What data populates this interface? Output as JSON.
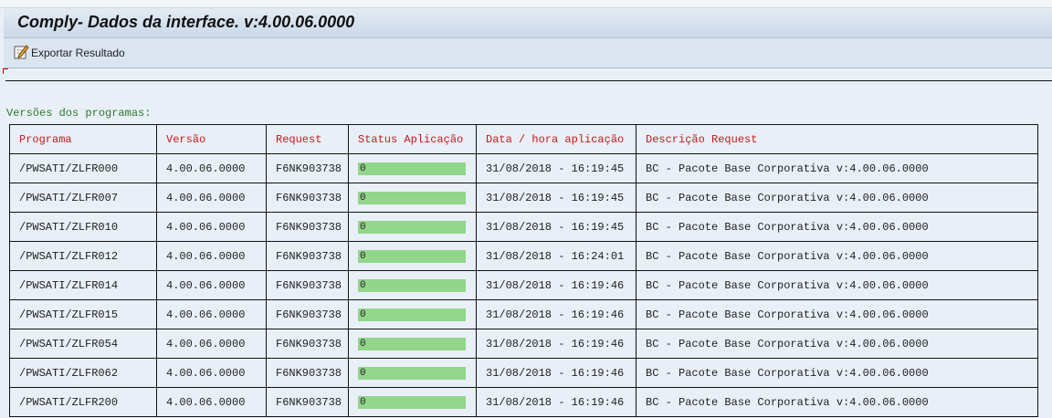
{
  "title": "Comply- Dados da interface. v:4.00.06.0000",
  "toolbar": {
    "export_label": "Exportar Resultado"
  },
  "section_label": "Versões dos programas:",
  "colors": {
    "status_bar": "#92d68b",
    "header_text": "#c41a1a",
    "label_text": "#2c7a2c"
  },
  "table": {
    "headers": [
      "Programa",
      "Versão",
      "Request",
      "Status Aplicação",
      "Data / hora aplicação",
      "Descrição Request"
    ],
    "rows": [
      {
        "programa": "/PWSATI/ZLFR000",
        "versao": "4.00.06.0000",
        "request": "F6NK903738",
        "status": "0",
        "data_hora": "31/08/2018 - 16:19:45",
        "descricao": "BC - Pacote Base Corporativa v:4.00.06.0000"
      },
      {
        "programa": "/PWSATI/ZLFR007",
        "versao": "4.00.06.0000",
        "request": "F6NK903738",
        "status": "0",
        "data_hora": "31/08/2018 - 16:19:45",
        "descricao": "BC - Pacote Base Corporativa v:4.00.06.0000"
      },
      {
        "programa": "/PWSATI/ZLFR010",
        "versao": "4.00.06.0000",
        "request": "F6NK903738",
        "status": "0",
        "data_hora": "31/08/2018 - 16:19:45",
        "descricao": "BC - Pacote Base Corporativa v:4.00.06.0000"
      },
      {
        "programa": "/PWSATI/ZLFR012",
        "versao": "4.00.06.0000",
        "request": "F6NK903738",
        "status": "0",
        "data_hora": "31/08/2018 - 16:24:01",
        "descricao": "BC - Pacote Base Corporativa v:4.00.06.0000"
      },
      {
        "programa": "/PWSATI/ZLFR014",
        "versao": "4.00.06.0000",
        "request": "F6NK903738",
        "status": "0",
        "data_hora": "31/08/2018 - 16:19:46",
        "descricao": "BC - Pacote Base Corporativa v:4.00.06.0000"
      },
      {
        "programa": "/PWSATI/ZLFR015",
        "versao": "4.00.06.0000",
        "request": "F6NK903738",
        "status": "0",
        "data_hora": "31/08/2018 - 16:19:46",
        "descricao": "BC - Pacote Base Corporativa v:4.00.06.0000"
      },
      {
        "programa": "/PWSATI/ZLFR054",
        "versao": "4.00.06.0000",
        "request": "F6NK903738",
        "status": "0",
        "data_hora": "31/08/2018 - 16:19:46",
        "descricao": "BC - Pacote Base Corporativa v:4.00.06.0000"
      },
      {
        "programa": "/PWSATI/ZLFR062",
        "versao": "4.00.06.0000",
        "request": "F6NK903738",
        "status": "0",
        "data_hora": "31/08/2018 - 16:19:46",
        "descricao": "BC - Pacote Base Corporativa v:4.00.06.0000"
      },
      {
        "programa": "/PWSATI/ZLFR200",
        "versao": "4.00.06.0000",
        "request": "F6NK903738",
        "status": "0",
        "data_hora": "31/08/2018 - 16:19:46",
        "descricao": "BC - Pacote Base Corporativa v:4.00.06.0000"
      }
    ]
  }
}
